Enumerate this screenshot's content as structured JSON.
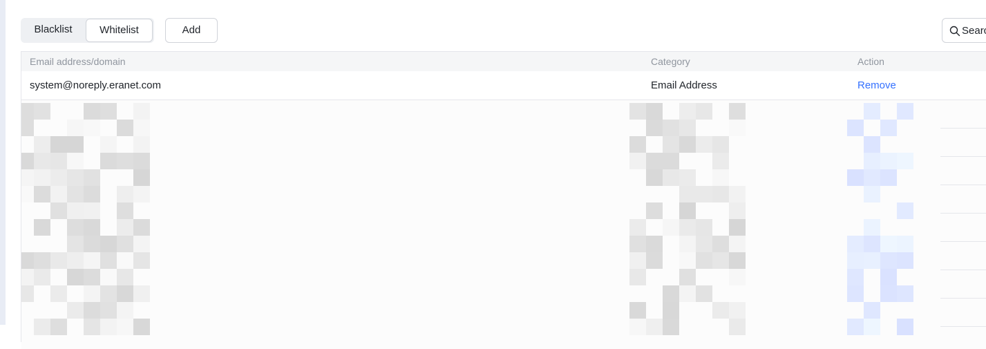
{
  "toolbar": {
    "tabs": [
      {
        "label": "Blacklist",
        "selected": false
      },
      {
        "label": "Whitelist",
        "selected": true
      }
    ],
    "add_label": "Add",
    "search_placeholder": "Search"
  },
  "table": {
    "columns": [
      "Email address/domain",
      "Category",
      "Action"
    ],
    "rows": [
      {
        "email": "system@noreply.eranet.com",
        "category": "Email Address",
        "action": "Remove"
      }
    ]
  },
  "colors": {
    "link": "#3370ff",
    "border": "#e5e6eb",
    "header_bg": "#f5f6f7",
    "muted_text": "#8f959e"
  }
}
